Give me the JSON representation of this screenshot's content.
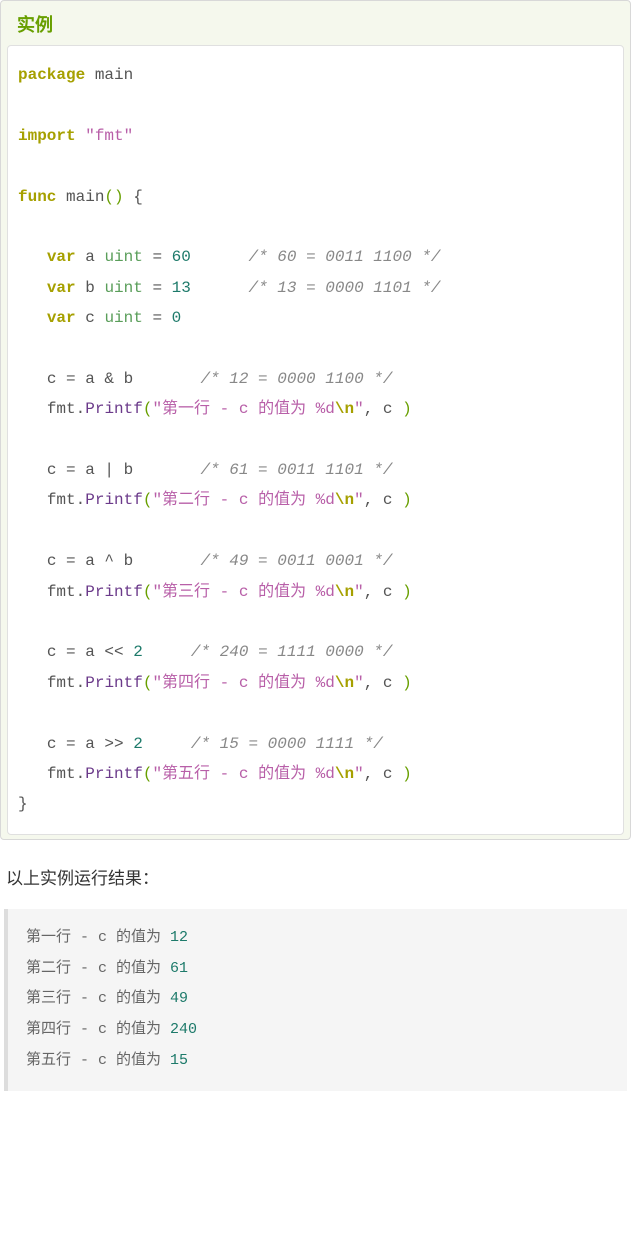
{
  "example": {
    "title": "实例",
    "code": {
      "package_kw": "package",
      "package_name": "main",
      "import_kw": "import",
      "import_val": "\"fmt\"",
      "func_kw": "func",
      "func_name": "main",
      "var_kw": "var",
      "type_uint": "uint",
      "var_a": "a",
      "var_b": "b",
      "var_c": "c",
      "val_60": "60",
      "val_13": "13",
      "val_0": "0",
      "val_2": "2",
      "cmt1": "/* 60 = 0011 1100 */",
      "cmt2": "/* 13 = 0000 1101 */",
      "cmt3": "/* 12 = 0000 1100 */",
      "cmt4": "/* 61 = 0011 1101 */",
      "cmt5": "/* 49 = 0011 0001 */",
      "cmt6": "/* 240 = 1111 0000 */",
      "cmt7": "/* 15 = 0000 1111 */",
      "fmt_obj": "fmt",
      "printf_fn": "Printf",
      "str1": "\"第一行 - c 的值为 %d",
      "str2": "\"第二行 - c 的值为 %d",
      "str3": "\"第三行 - c 的值为 %d",
      "str4": "\"第四行 - c 的值为 %d",
      "str5": "\"第五行 - c 的值为 %d",
      "esc_n": "\\n",
      "str_close": "\""
    }
  },
  "result_intro": "以上实例运行结果：",
  "output": {
    "lines": [
      {
        "prefix": "第一行 - c 的值为 ",
        "value": "12"
      },
      {
        "prefix": "第二行 - c 的值为 ",
        "value": "61"
      },
      {
        "prefix": "第三行 - c 的值为 ",
        "value": "49"
      },
      {
        "prefix": "第四行 - c 的值为 ",
        "value": "240"
      },
      {
        "prefix": "第五行 - c 的值为 ",
        "value": "15"
      }
    ]
  }
}
